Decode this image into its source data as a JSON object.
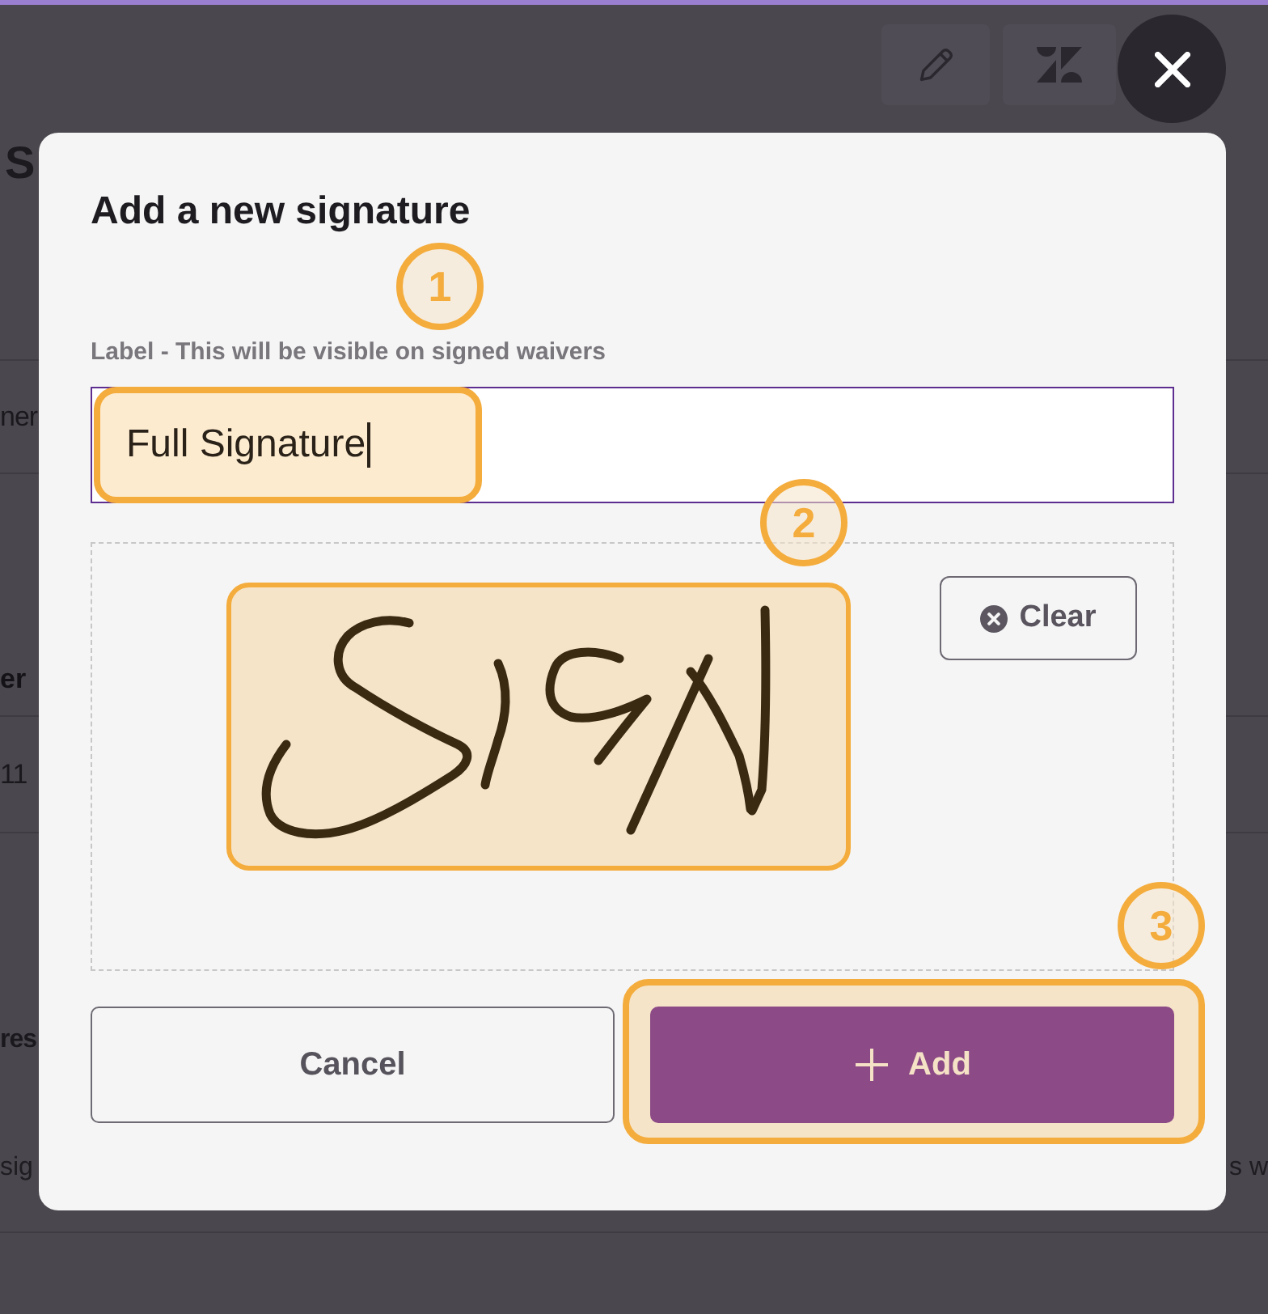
{
  "page_behind": {
    "title": "S",
    "table": {
      "cell_1": "ner",
      "column_header": "er",
      "cell_2": "11"
    },
    "section_heading": "res",
    "description_start": "sig",
    "description_end": "s w"
  },
  "dialog": {
    "title": "Add a new signature",
    "label_field": {
      "label": "Label - This will be visible on signed waivers",
      "value": "Full Signature",
      "focused": true,
      "callout": "1"
    },
    "signature_pad": {
      "signed": true,
      "callout": "2",
      "clear_button": {
        "label": "Clear"
      }
    },
    "buttons": [
      {
        "kind": "secondary",
        "label": "Cancel"
      },
      {
        "kind": "primary",
        "label": "Add",
        "callout": "3"
      }
    ]
  }
}
